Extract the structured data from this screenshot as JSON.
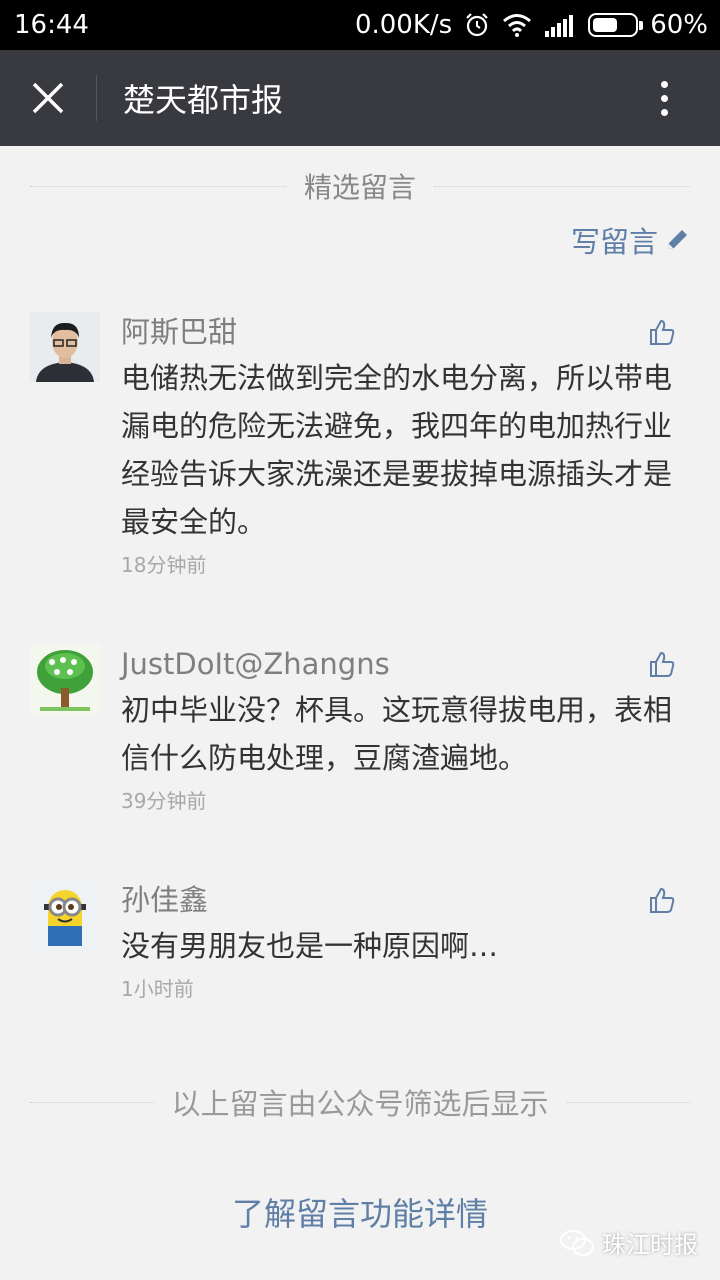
{
  "status_bar": {
    "time": "16:44",
    "network_speed": "0.00K/s",
    "battery_percent": "60%",
    "battery_level": 0.6
  },
  "title_bar": {
    "title": "楚天都市报"
  },
  "section": {
    "title": "精选留言",
    "write_label": "写留言"
  },
  "comments": [
    {
      "nickname": "阿斯巴甜",
      "content": "电储热无法做到完全的水电分离，所以带电漏电的危险无法避免，我四年的电加热行业经验告诉大家洗澡还是要拔掉电源插头才是最安全的。",
      "time": "18分钟前"
    },
    {
      "nickname": "JustDoIt@Zhangns",
      "content": "初中毕业没？杯具。这玩意得拔电用，表相信什么防电处理，豆腐渣遍地。",
      "time": "39分钟前"
    },
    {
      "nickname": "孙佳鑫",
      "content": "没有男朋友也是一种原因啊…",
      "time": "1小时前"
    }
  ],
  "footer": {
    "note": "以上留言由公众号筛选后显示",
    "learn_more": "了解留言功能详情"
  },
  "watermark": {
    "text": "珠江时报"
  },
  "colors": {
    "title_bar_bg": "#393a3f",
    "link_blue": "#607fa6",
    "page_bg": "#f2f2f2"
  }
}
